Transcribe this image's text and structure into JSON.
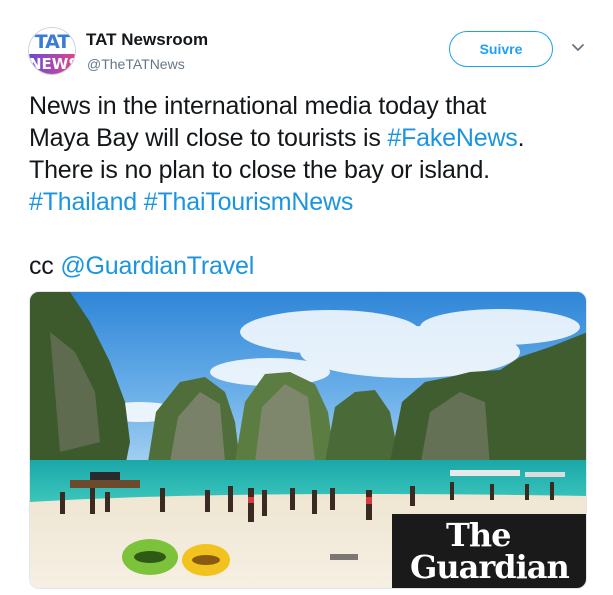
{
  "account": {
    "display_name": "TAT Newsroom",
    "handle": "@TheTATNews",
    "avatar_text_top": "TAT",
    "avatar_text_bottom": "NEWS"
  },
  "actions": {
    "follow_label": "Suivre",
    "more_icon": "chevron-down-icon"
  },
  "tweet": {
    "line1": "News in the international media today that",
    "line2_text": "Maya Bay will close to tourists is ",
    "hashtag_fakenews": "#FakeNews",
    "line2_end": ".",
    "line3": "There is no plan to close the bay or island.",
    "hashtag_thailand": "#Thailand",
    "hashtag_thaitourism": "#ThaiTourismNews",
    "cc_text": "cc ",
    "mention": "@GuardianTravel"
  },
  "media": {
    "watermark_line1": "The",
    "watermark_line2": "Guardian"
  },
  "colors": {
    "link": "#1b95e0",
    "follow_border": "#1da1f2",
    "text": "#14171a",
    "secondary": "#657786"
  }
}
